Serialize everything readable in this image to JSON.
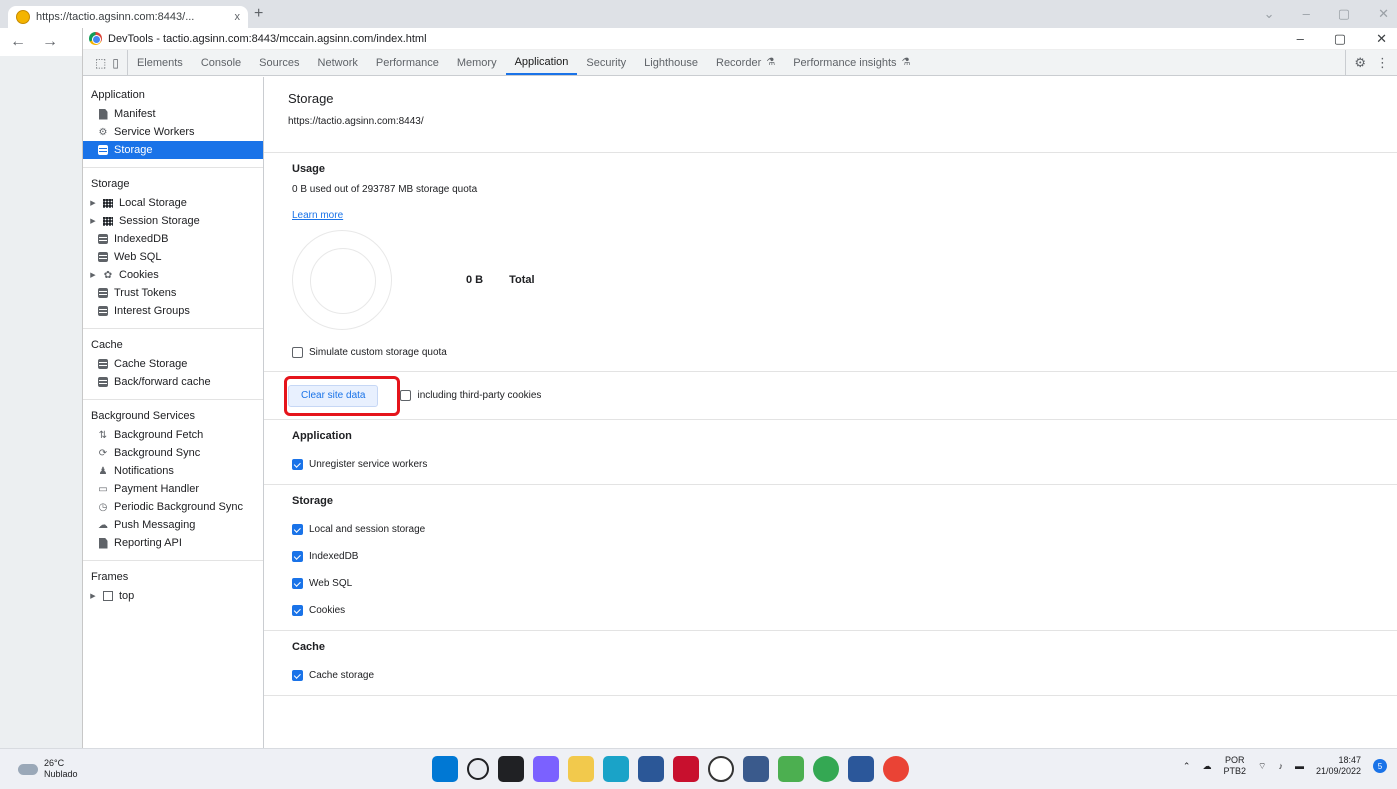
{
  "browser": {
    "tab_title": "https://tactio.agsinn.com:8443/...",
    "tab_close": "x",
    "new_tab": "+",
    "back": "←",
    "forward": "→"
  },
  "devtools": {
    "window_title": "DevTools - tactio.agsinn.com:8443/mccain.agsinn.com/index.html",
    "tabs": [
      {
        "label": "Elements"
      },
      {
        "label": "Console"
      },
      {
        "label": "Sources"
      },
      {
        "label": "Network"
      },
      {
        "label": "Performance"
      },
      {
        "label": "Memory"
      },
      {
        "label": "Application",
        "active": true
      },
      {
        "label": "Security"
      },
      {
        "label": "Lighthouse"
      },
      {
        "label": "Recorder"
      },
      {
        "label": "Performance insights"
      }
    ]
  },
  "sidebar": {
    "application": {
      "header": "Application",
      "items": [
        "Manifest",
        "Service Workers",
        "Storage"
      ]
    },
    "storage": {
      "header": "Storage",
      "items": [
        "Local Storage",
        "Session Storage",
        "IndexedDB",
        "Web SQL",
        "Cookies",
        "Trust Tokens",
        "Interest Groups"
      ]
    },
    "cache": {
      "header": "Cache",
      "items": [
        "Cache Storage",
        "Back/forward cache"
      ]
    },
    "background": {
      "header": "Background Services",
      "items": [
        "Background Fetch",
        "Background Sync",
        "Notifications",
        "Payment Handler",
        "Periodic Background Sync",
        "Push Messaging",
        "Reporting API"
      ]
    },
    "frames": {
      "header": "Frames",
      "items": [
        "top"
      ]
    }
  },
  "main": {
    "title": "Storage",
    "origin": "https://tactio.agsinn.com:8443/",
    "usage": {
      "title": "Usage",
      "text": "0 B used out of 293787 MB storage quota",
      "learn_more": "Learn more",
      "pie_value": "0 B",
      "pie_label": "Total",
      "simulate_label": "Simulate custom storage quota"
    },
    "clear_button": "Clear site data",
    "third_party_label": "including third-party cookies",
    "application_section": {
      "title": "Application",
      "items": [
        "Unregister service workers"
      ]
    },
    "storage_section": {
      "title": "Storage",
      "items": [
        "Local and session storage",
        "IndexedDB",
        "Web SQL",
        "Cookies"
      ]
    },
    "cache_section": {
      "title": "Cache",
      "items": [
        "Cache storage"
      ]
    }
  },
  "taskbar": {
    "temperature": "26°C",
    "weather": "Nublado",
    "lang1": "POR",
    "lang2": "PTB2",
    "time": "18:47",
    "date": "21/09/2022",
    "notif_count": "5"
  },
  "colors": {
    "accent": "#1a73e8",
    "highlight": "#e5141b"
  }
}
